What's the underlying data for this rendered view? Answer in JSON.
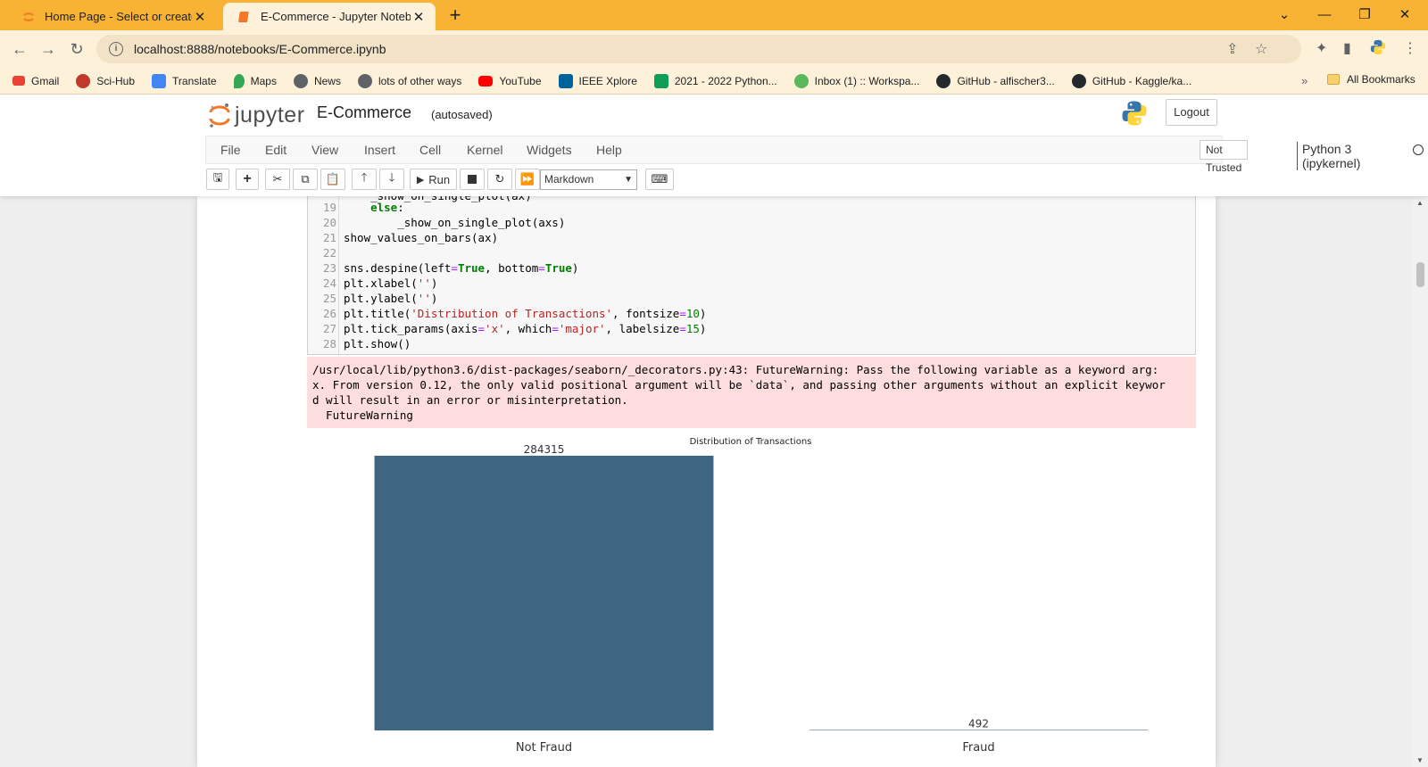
{
  "browser": {
    "tabs": [
      {
        "title": "Home Page - Select or create a n",
        "active": false
      },
      {
        "title": "E-Commerce - Jupyter Noteboo",
        "active": true
      }
    ],
    "url": "localhost:8888/notebooks/E-Commerce.ipynb",
    "bookmarks": [
      {
        "label": "Gmail",
        "icon": "gmail-icon",
        "color": "#ea4335"
      },
      {
        "label": "Sci-Hub",
        "icon": "scihub-icon",
        "color": "#c0392b"
      },
      {
        "label": "Translate",
        "icon": "translate-icon",
        "color": "#4285f4"
      },
      {
        "label": "Maps",
        "icon": "maps-icon",
        "color": "#34a853"
      },
      {
        "label": "News",
        "icon": "globe-icon",
        "color": "#5f6368"
      },
      {
        "label": "lots of other ways",
        "icon": "globe-icon",
        "color": "#5f6368"
      },
      {
        "label": "YouTube",
        "icon": "youtube-icon",
        "color": "#ff0000"
      },
      {
        "label": "IEEE Xplore",
        "icon": "ieee-icon",
        "color": "#00629b"
      },
      {
        "label": "2021 - 2022 Python...",
        "icon": "sheets-icon",
        "color": "#0f9d58"
      },
      {
        "label": "Inbox (1) :: Workspa...",
        "icon": "mail-icon",
        "color": "#5cb85c"
      },
      {
        "label": "GitHub - alfischer3...",
        "icon": "github-icon",
        "color": "#24292e"
      },
      {
        "label": "GitHub - Kaggle/ka...",
        "icon": "github-icon",
        "color": "#24292e"
      }
    ],
    "all_bookmarks": "All Bookmarks",
    "more": "»"
  },
  "jupyter": {
    "logo_text": "jupyter",
    "notebook_name": "E-Commerce",
    "autosave": "(autosaved)",
    "logout": "Logout",
    "menus": [
      "File",
      "Edit",
      "View",
      "Insert",
      "Cell",
      "Kernel",
      "Widgets",
      "Help"
    ],
    "trust": "Not Trusted",
    "kernel": "Python 3 (ipykernel)",
    "run_label": "Run",
    "cell_type": "Markdown"
  },
  "code": {
    "partial_top": "    _show_on_single_plot(ax)",
    "lines": [
      {
        "n": "19"
      },
      {
        "n": "20"
      },
      {
        "n": "21"
      },
      {
        "n": "22"
      },
      {
        "n": "23"
      },
      {
        "n": "24"
      },
      {
        "n": "25"
      },
      {
        "n": "26"
      },
      {
        "n": "27"
      },
      {
        "n": "28"
      }
    ]
  },
  "warning": {
    "lines": [
      "/usr/local/lib/python3.6/dist-packages/seaborn/_decorators.py:43: FutureWarning: Pass the following variable as a keyword arg:",
      "x. From version 0.12, the only valid positional argument will be `data`, and passing other arguments without an explicit keywor",
      "d will result in an error or misinterpretation.",
      "  FutureWarning"
    ]
  },
  "chart_data": {
    "type": "bar",
    "title": "Distribution of Transactions",
    "categories": [
      "Not Fraud",
      "Fraud"
    ],
    "values": [
      284315,
      492
    ],
    "value_labels": [
      "284315",
      "492"
    ],
    "bar_color": "#3e6682",
    "ylim": [
      0,
      284315
    ],
    "xlabel": "",
    "ylabel": "",
    "grid": false
  }
}
